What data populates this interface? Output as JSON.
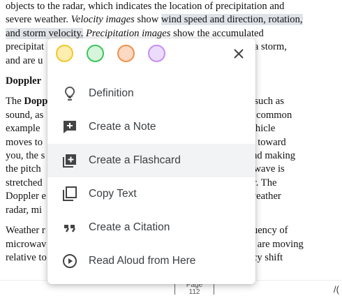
{
  "document": {
    "lines": [
      [
        {
          "t": "objects to the radar, which indicates the location of precipitation and"
        }
      ],
      [
        {
          "t": "severe weather. "
        },
        {
          "t": "Velocity images",
          "s": "em"
        },
        {
          "t": " show "
        },
        {
          "t": "wind speed and direction, rotation,",
          "s": "hl"
        }
      ],
      [
        {
          "t": "and storm velocity.",
          "s": "hl"
        },
        {
          "t": " "
        },
        {
          "t": "Precipitation images",
          "s": "em"
        },
        {
          "t": " show the accumulated"
        }
      ],
      [
        {
          "t": "precipitat"
        },
        {
          "t": "                                                                       during a storm,"
        }
      ],
      [
        {
          "t": "and are u"
        }
      ]
    ],
    "heading": "Doppler",
    "para2": [
      [
        {
          "t": "The "
        },
        {
          "t": "Dopp",
          "s": "b"
        },
        {
          "t": "                                                                        aves, such as"
        }
      ],
      [
        {
          "t": "sound, as"
        },
        {
          "t": "                                                                        e most common"
        }
      ],
      [
        {
          "t": "example"
        },
        {
          "t": "                                                                          ncy vehicle"
        }
      ],
      [
        {
          "t": "moves to"
        },
        {
          "t": "                                                                         moves toward"
        }
      ],
      [
        {
          "t": "you, the s"
        },
        {
          "t": "                                                                       ency and making"
        }
      ],
      [
        {
          "t": "the pitch"
        },
        {
          "t": "                                                                         sound wave is"
        }
      ],
      [
        {
          "t": "stretched"
        },
        {
          "t": "                                                                        h lower. The"
        }
      ],
      [
        {
          "t": "Doppler e"
        },
        {
          "t": "                                                                       se of weather"
        }
      ],
      [
        {
          "t": "radar, mi"
        }
      ]
    ],
    "para3": [
      [
        {
          "t": "Weather r"
        },
        {
          "t": "                                                                        n frequency of"
        }
      ],
      [
        {
          "t": "microwav"
        },
        {
          "t": "                                                                         ource are moving"
        }
      ],
      [
        {
          "t": "relative to"
        },
        {
          "t": "                                                                      requency shift"
        }
      ]
    ]
  },
  "footer": {
    "page_label": "Page",
    "page_number": "112",
    "corner_glyph": "/("
  },
  "menu": {
    "highlight_colors": [
      {
        "name": "yellow",
        "fill": "#fdeeb0",
        "border": "#f2c62c"
      },
      {
        "name": "green",
        "fill": "#d6f5dc",
        "border": "#3cc45a"
      },
      {
        "name": "orange",
        "fill": "#fbd9c3",
        "border": "#f2914c"
      },
      {
        "name": "purple",
        "fill": "#ecdcfb",
        "border": "#c68ef4"
      }
    ],
    "close_icon": "close-icon",
    "items": [
      {
        "label": "Definition",
        "icon": "lightbulb-icon"
      },
      {
        "label": "Create a Note",
        "icon": "note-add-icon"
      },
      {
        "label": "Create a Flashcard",
        "icon": "flashcard-add-icon",
        "active": true
      },
      {
        "label": "Copy Text",
        "icon": "copy-icon"
      },
      {
        "label": "Create a Citation",
        "icon": "quote-icon"
      },
      {
        "label": "Read Aloud from Here",
        "icon": "play-circle-icon"
      }
    ]
  }
}
